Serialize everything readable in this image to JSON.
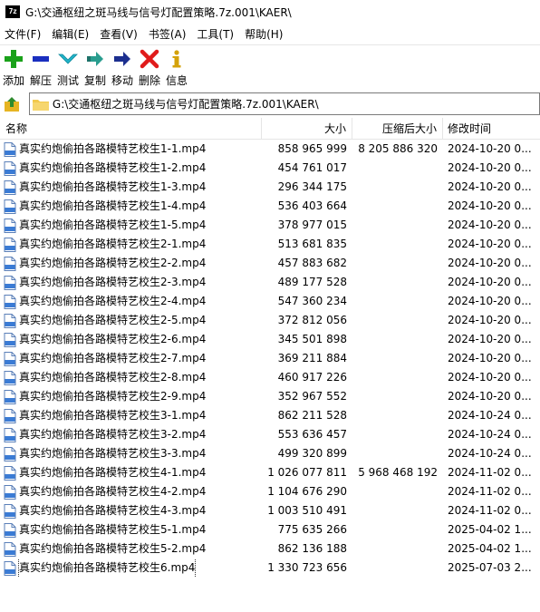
{
  "window": {
    "logo_text": "7z",
    "title": "G:\\交通枢纽之斑马线与信号灯配置策略.7z.001\\KAER\\"
  },
  "menu": [
    {
      "label": "文件(F)"
    },
    {
      "label": "编辑(E)"
    },
    {
      "label": "查看(V)"
    },
    {
      "label": "书签(A)"
    },
    {
      "label": "工具(T)"
    },
    {
      "label": "帮助(H)"
    }
  ],
  "toolbar": {
    "add_label": "添加",
    "extract_label": "解压",
    "test_label": "测试",
    "copy_label": "复制",
    "move_label": "移动",
    "delete_label": "删除",
    "info_label": "信息"
  },
  "address": {
    "path": "G:\\交通枢纽之斑马线与信号灯配置策略.7z.001\\KAER\\"
  },
  "columns": {
    "name": "名称",
    "size": "大小",
    "packed": "压缩后大小",
    "mtime": "修改时间"
  },
  "files": [
    {
      "name": "真实约炮偷拍各路模特艺校生1-1.mp4",
      "size": "858 965 999",
      "packed": "8 205 886 320",
      "mtime": "2024-10-20 0..."
    },
    {
      "name": "真实约炮偷拍各路模特艺校生1-2.mp4",
      "size": "454 761 017",
      "packed": "",
      "mtime": "2024-10-20 0..."
    },
    {
      "name": "真实约炮偷拍各路模特艺校生1-3.mp4",
      "size": "296 344 175",
      "packed": "",
      "mtime": "2024-10-20 0..."
    },
    {
      "name": "真实约炮偷拍各路模特艺校生1-4.mp4",
      "size": "536 403 664",
      "packed": "",
      "mtime": "2024-10-20 0..."
    },
    {
      "name": "真实约炮偷拍各路模特艺校生1-5.mp4",
      "size": "378 977 015",
      "packed": "",
      "mtime": "2024-10-20 0..."
    },
    {
      "name": "真实约炮偷拍各路模特艺校生2-1.mp4",
      "size": "513 681 835",
      "packed": "",
      "mtime": "2024-10-20 0..."
    },
    {
      "name": "真实约炮偷拍各路模特艺校生2-2.mp4",
      "size": "457 883 682",
      "packed": "",
      "mtime": "2024-10-20 0..."
    },
    {
      "name": "真实约炮偷拍各路模特艺校生2-3.mp4",
      "size": "489 177 528",
      "packed": "",
      "mtime": "2024-10-20 0..."
    },
    {
      "name": "真实约炮偷拍各路模特艺校生2-4.mp4",
      "size": "547 360 234",
      "packed": "",
      "mtime": "2024-10-20 0..."
    },
    {
      "name": "真实约炮偷拍各路模特艺校生2-5.mp4",
      "size": "372 812 056",
      "packed": "",
      "mtime": "2024-10-20 0..."
    },
    {
      "name": "真实约炮偷拍各路模特艺校生2-6.mp4",
      "size": "345 501 898",
      "packed": "",
      "mtime": "2024-10-20 0..."
    },
    {
      "name": "真实约炮偷拍各路模特艺校生2-7.mp4",
      "size": "369 211 884",
      "packed": "",
      "mtime": "2024-10-20 0..."
    },
    {
      "name": "真实约炮偷拍各路模特艺校生2-8.mp4",
      "size": "460 917 226",
      "packed": "",
      "mtime": "2024-10-20 0..."
    },
    {
      "name": "真实约炮偷拍各路模特艺校生2-9.mp4",
      "size": "352 967 552",
      "packed": "",
      "mtime": "2024-10-20 0..."
    },
    {
      "name": "真实约炮偷拍各路模特艺校生3-1.mp4",
      "size": "862 211 528",
      "packed": "",
      "mtime": "2024-10-24 0..."
    },
    {
      "name": "真实约炮偷拍各路模特艺校生3-2.mp4",
      "size": "553 636 457",
      "packed": "",
      "mtime": "2024-10-24 0..."
    },
    {
      "name": "真实约炮偷拍各路模特艺校生3-3.mp4",
      "size": "499 320 899",
      "packed": "",
      "mtime": "2024-10-24 0..."
    },
    {
      "name": "真实约炮偷拍各路模特艺校生4-1.mp4",
      "size": "1 026 077 811",
      "packed": "5 968 468 192",
      "mtime": "2024-11-02 0..."
    },
    {
      "name": "真实约炮偷拍各路模特艺校生4-2.mp4",
      "size": "1 104 676 290",
      "packed": "",
      "mtime": "2024-11-02 0..."
    },
    {
      "name": "真实约炮偷拍各路模特艺校生4-3.mp4",
      "size": "1 003 510 491",
      "packed": "",
      "mtime": "2024-11-02 0..."
    },
    {
      "name": "真实约炮偷拍各路模特艺校生5-1.mp4",
      "size": "775 635 266",
      "packed": "",
      "mtime": "2025-04-02 1..."
    },
    {
      "name": "真实约炮偷拍各路模特艺校生5-2.mp4",
      "size": "862 136 188",
      "packed": "",
      "mtime": "2025-04-02 1..."
    },
    {
      "name": "真实约炮偷拍各路模特艺校生6.mp4",
      "size": "1 330 723 656",
      "packed": "",
      "mtime": "2025-07-03 2..."
    }
  ],
  "colors": {
    "add": "#1aa11a",
    "extract": "#1a2fbf",
    "test": "#21b3c9",
    "copy": "#2a9d8f",
    "move": "#1c2f8f",
    "delete": "#e01b1b",
    "info": "#d4a20a",
    "folder": "#f2c94c",
    "file_icon": "#3a7bd5"
  }
}
